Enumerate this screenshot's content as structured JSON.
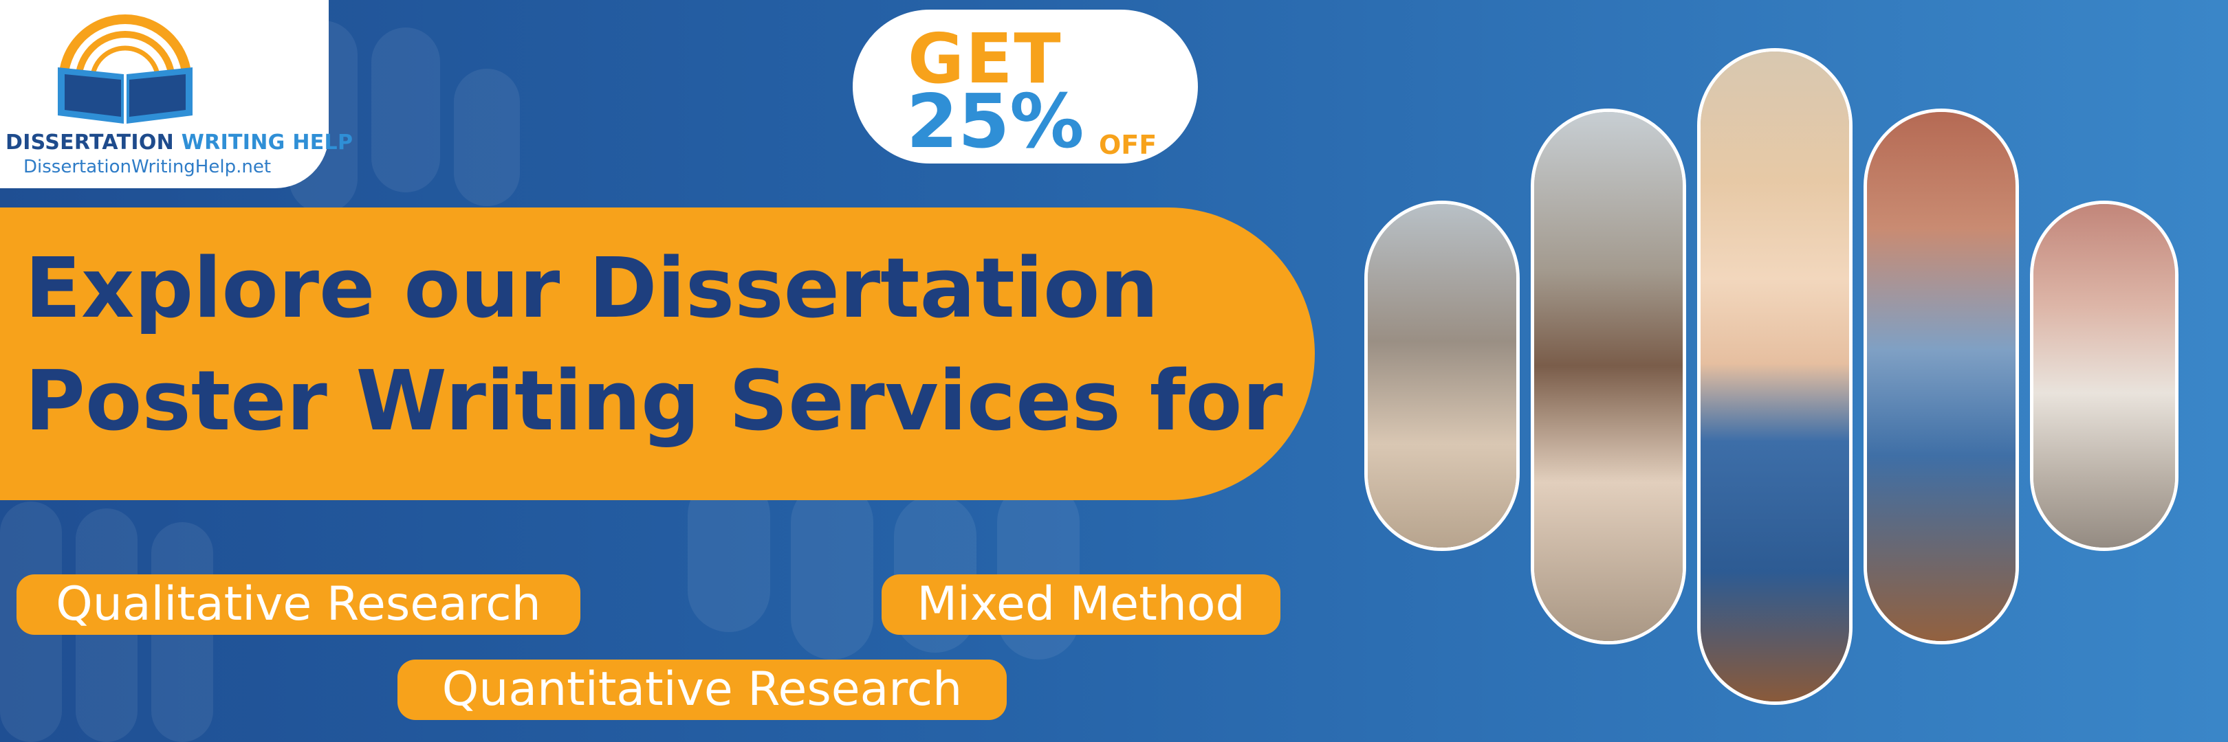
{
  "brand": {
    "name_main": "DISSERTATION ",
    "name_accent": "WRITING HELP",
    "url": "DissertationWritingHelp.net",
    "logo_icon": "open-book-sunrise-icon"
  },
  "offer": {
    "get": "GET",
    "percent": "25%",
    "off": "OFF"
  },
  "headline": {
    "line1": "Explore our Dissertation",
    "line2": "Poster Writing Services for"
  },
  "services": [
    {
      "label": "Qualitative Research"
    },
    {
      "label": "Mixed Method"
    },
    {
      "label": "Quantitative Research"
    }
  ],
  "colors": {
    "background_start": "#1f4f93",
    "background_end": "#3a86c8",
    "accent_orange": "#f7a21b",
    "headline_text": "#1e3f7e",
    "brand_blue": "#2f8fd6"
  },
  "photo": {
    "icon": "smiling-student-photo"
  }
}
